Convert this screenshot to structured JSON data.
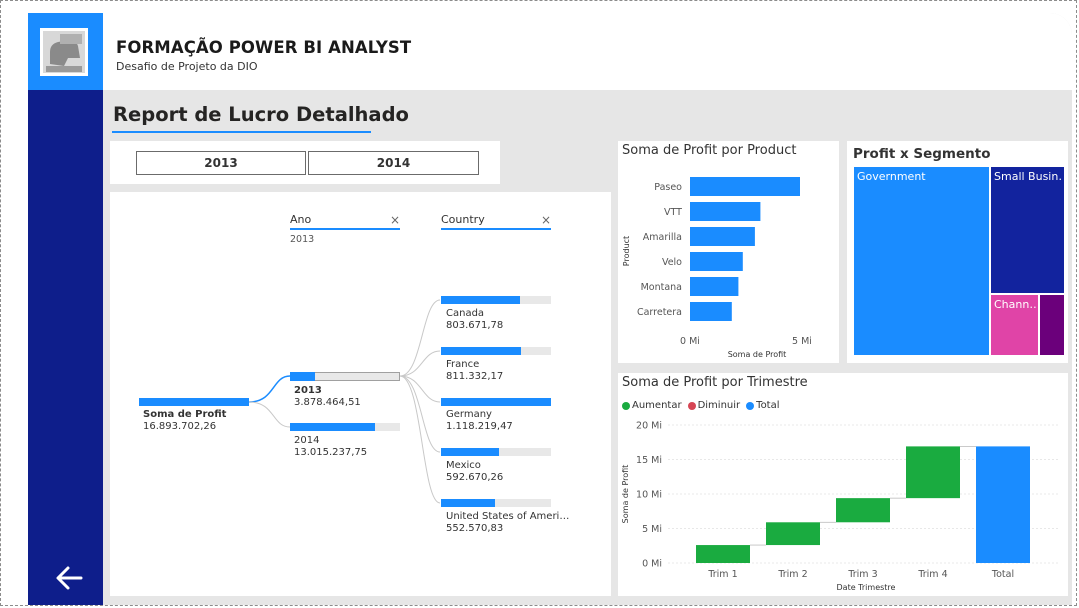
{
  "header": {
    "title": "FORMAÇÃO POWER BI ANALYST",
    "subtitle": "Desafio de Projeto da DIO"
  },
  "report": {
    "title": "Report de Lucro Detalhado"
  },
  "year_slicer": {
    "options": [
      "2013",
      "2014"
    ]
  },
  "decomposition_tree": {
    "root": {
      "label": "Soma de Profit",
      "value": "16.893.702,26"
    },
    "level1": {
      "header": "Ano",
      "selected": "2013",
      "items": [
        {
          "label": "2013",
          "value": "3.878.464,51",
          "fill": 0.23,
          "selected": true
        },
        {
          "label": "2014",
          "value": "13.015.237,75",
          "fill": 0.77,
          "selected": false
        }
      ]
    },
    "level2": {
      "header": "Country",
      "items": [
        {
          "label": "Canada",
          "value": "803.671,78",
          "fill": 0.72
        },
        {
          "label": "France",
          "value": "811.332,17",
          "fill": 0.73
        },
        {
          "label": "Germany",
          "value": "1.118.219,47",
          "fill": 1.0
        },
        {
          "label": "Mexico",
          "value": "592.670,26",
          "fill": 0.53
        },
        {
          "label": "United States of Ameri…",
          "value": "552.570,83",
          "fill": 0.49
        }
      ]
    }
  },
  "product_chart": {
    "title": "Soma de Profit por Product",
    "chart_data": {
      "type": "bar",
      "orientation": "horizontal",
      "categories": [
        "Paseo",
        "VTT",
        "Amarilla",
        "Velo",
        "Montana",
        "Carretera"
      ],
      "values": [
        5.0,
        3.2,
        2.95,
        2.4,
        2.2,
        1.9
      ],
      "unit": "Mi",
      "xlabel": "Soma de Profit",
      "ylabel": "Product",
      "xlim": [
        0,
        5
      ],
      "xticks": [
        "0 Mi",
        "5 Mi"
      ],
      "color": "#1a8cff"
    }
  },
  "segment_treemap": {
    "title": "Profit x Segmento",
    "chart_data": {
      "type": "treemap",
      "items": [
        {
          "label": "Government",
          "color": "#1a8cff"
        },
        {
          "label": "Small Busin…",
          "color": "#12239e"
        },
        {
          "label": "Chann…",
          "color": "#e044a7"
        },
        {
          "label": "",
          "color": "#6b007b"
        }
      ]
    }
  },
  "quarter_chart": {
    "title": "Soma de Profit por Trimestre",
    "legend": [
      {
        "label": "Aumentar",
        "color": "#1aab40"
      },
      {
        "label": "Diminuir",
        "color": "#d64554"
      },
      {
        "label": "Total",
        "color": "#1a8cff"
      }
    ],
    "chart_data": {
      "type": "waterfall",
      "categories": [
        "Trim 1",
        "Trim 2",
        "Trim 3",
        "Trim 4",
        "Total"
      ],
      "values": [
        2.6,
        3.3,
        3.5,
        7.5,
        16.9
      ],
      "unit": "Mi",
      "xlabel": "Date Trimestre",
      "ylabel": "Soma de Profit",
      "ylim": [
        0,
        20
      ],
      "yticks": [
        "0 Mi",
        "5 Mi",
        "10 Mi",
        "15 Mi",
        "20 Mi"
      ]
    }
  }
}
